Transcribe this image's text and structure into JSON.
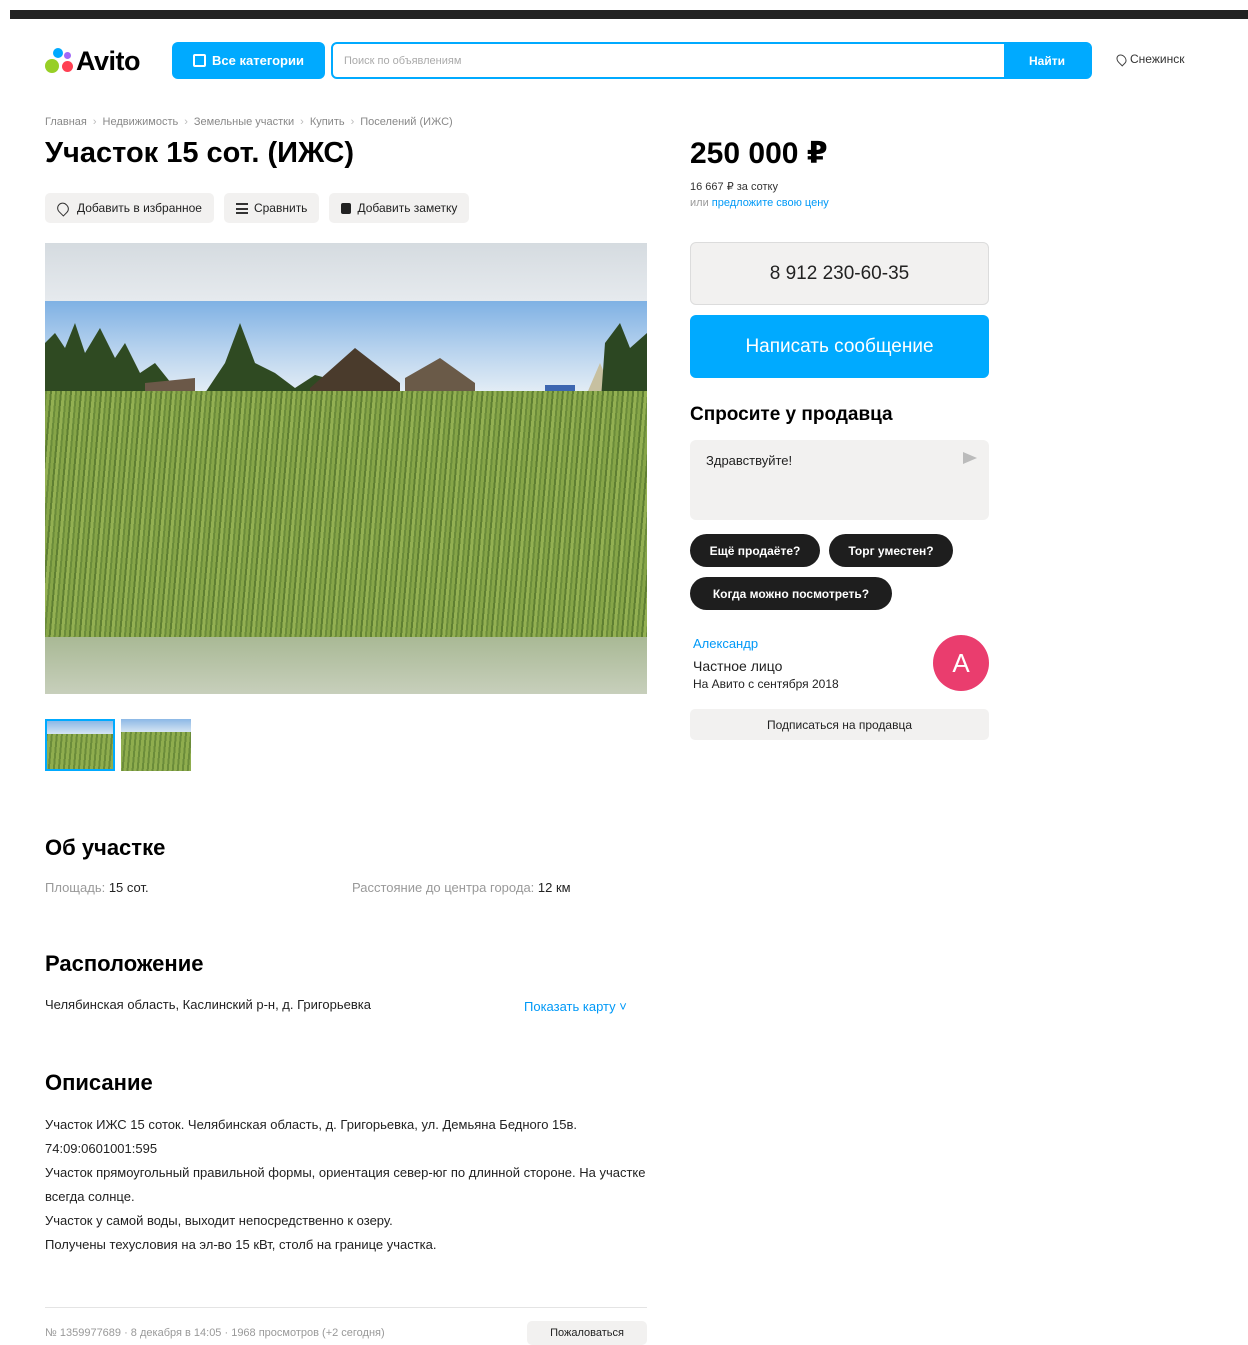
{
  "header": {
    "logo_text": "Avito",
    "categories_label": "Все категории",
    "search_placeholder": "Поиск по объявлениям",
    "search_button": "Найти",
    "location": "Снежинск"
  },
  "breadcrumbs": [
    "Главная",
    "Недвижимость",
    "Земельные участки",
    "Купить",
    "Поселений (ИЖС)"
  ],
  "listing": {
    "title": "Участок 15 сот. (ИЖС)",
    "actions": {
      "favorite": "Добавить в избранное",
      "compare": "Сравнить",
      "note": "Добавить заметку"
    }
  },
  "about": {
    "heading": "Об участке",
    "area_label": "Площадь:",
    "area_value": "15 сот.",
    "distance_label": "Расстояние до центра города:",
    "distance_value": "12 км"
  },
  "location_section": {
    "heading": "Расположение",
    "address": "Челябинская область, Каслинский р-н, д. Григорьевка",
    "show_map": "Показать карту ˅"
  },
  "description": {
    "heading": "Описание",
    "lines": [
      "Участок ИЖС 15 соток. Челябинская область, д. Григорьевка, ул. Демьяна Бедного 15в. 74:09:0601001:595",
      "Участок прямоугольный правильной формы, ориентация север-юг по длинной стороне. На участке всегда солнце.",
      "Участок у самой воды, выходит непосредственно к озеру.",
      "Получены техусловия на эл-во 15 кВт, столб на границе участка."
    ]
  },
  "footer": {
    "info": "№ 1359977689 · 8 декабря в 14:05 · 1968 просмотров (+2 сегодня)",
    "complain": "Пожаловаться"
  },
  "sidebar": {
    "price": "250 000 ₽",
    "price_per": "16 667 ₽ за сотку",
    "offer_prefix": "или",
    "offer_link": "предложите свою цену",
    "phone": "8 912 230-60-35",
    "message_button": "Написать сообщение",
    "ask_title": "Спросите у продавца",
    "ask_placeholder": "Здравствуйте!",
    "chips": [
      "Ещё продаёте?",
      "Торг уместен?",
      "Когда можно посмотреть?"
    ],
    "seller_name": "Александр",
    "seller_type": "Частное лицо",
    "seller_since": "На Авито с сентября 2018",
    "avatar_letter": "А",
    "subscribe": "Подписаться на продавца"
  }
}
